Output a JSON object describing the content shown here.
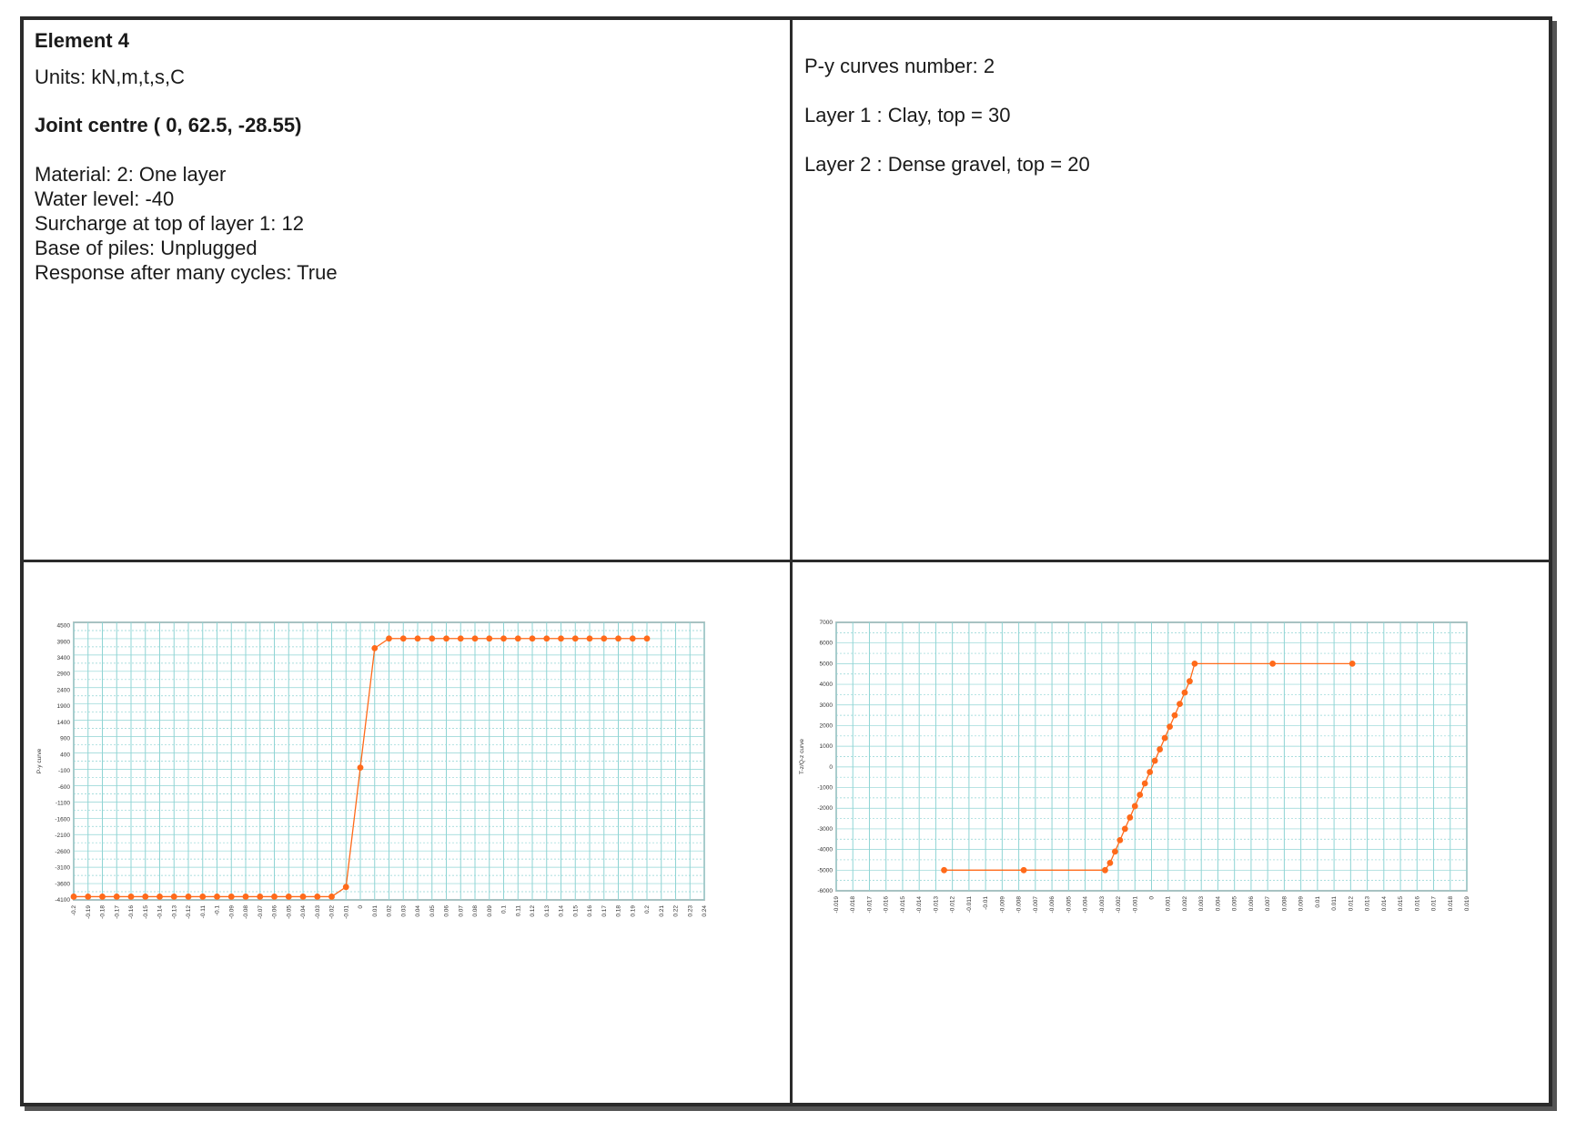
{
  "element": {
    "title": "Element 4",
    "units": "Units: kN,m,t,s,C",
    "joint_centre": "Joint centre ( 0, 62.5, -28.55)",
    "material": "Material: 2: One layer",
    "water_level": "Water level: -40",
    "surcharge": "Surcharge at top of layer 1: 12",
    "base_of_piles": "Base of piles: Unplugged",
    "response": "Response after many cycles: True"
  },
  "layers": {
    "py_curves": "P-y curves number: 2",
    "layer1": "Layer 1 : Clay, top = 30",
    "layer2": "Layer 2 : Dense gravel, top = 20"
  },
  "colors": {
    "grid": "#8fd4d4",
    "series": "#ff6a1a",
    "axis": "#555555"
  },
  "chart_data": [
    {
      "type": "line",
      "ylabel": "P-y curve",
      "xlabel": "",
      "title": "",
      "grid": true,
      "xlim": [
        -0.2,
        0.24
      ],
      "ylim": [
        -4100,
        4500
      ],
      "x_ticks": [
        -0.2,
        -0.19,
        -0.18,
        -0.17,
        -0.16,
        -0.15,
        -0.14,
        -0.13,
        -0.12,
        -0.11,
        -0.1,
        -0.09,
        -0.08,
        -0.07,
        -0.06,
        -0.05,
        -0.04,
        -0.03,
        -0.02,
        -0.01,
        0,
        0.01,
        0.02,
        0.03,
        0.04,
        0.05,
        0.06,
        0.07,
        0.08,
        0.09,
        0.1,
        0.11,
        0.12,
        0.13,
        0.14,
        0.15,
        0.16,
        0.17,
        0.18,
        0.19,
        0.2,
        0.21,
        0.22,
        0.23,
        0.24
      ],
      "y_ticks": [
        -4100,
        -3600,
        -3100,
        -2600,
        -2100,
        -1600,
        -1100,
        -600,
        -100,
        400,
        900,
        1400,
        1900,
        2400,
        2900,
        3400,
        3900,
        4400
      ],
      "y_tick_labels": [
        "-4100",
        "-3600",
        "-3100",
        "-2600",
        "-2100",
        "-1600",
        "-1100",
        "-600",
        "-100",
        "400",
        "900",
        "1400",
        "1900",
        "2400",
        "2900",
        "3400",
        "3900",
        "4500"
      ],
      "series": [
        {
          "x": [
            -0.2,
            -0.19,
            -0.18,
            -0.17,
            -0.16,
            -0.15,
            -0.14,
            -0.13,
            -0.12,
            -0.11,
            -0.1,
            -0.09,
            -0.08,
            -0.07,
            -0.06,
            -0.05,
            -0.04,
            -0.03,
            -0.02,
            -0.01,
            0,
            0.01,
            0.02,
            0.03,
            0.04,
            0.05,
            0.06,
            0.07,
            0.08,
            0.09,
            0.1,
            0.11,
            0.12,
            0.13,
            0.14,
            0.15,
            0.16,
            0.17,
            0.18,
            0.19,
            0.2
          ],
          "y": [
            -4000,
            -4000,
            -4000,
            -4000,
            -4000,
            -4000,
            -4000,
            -4000,
            -4000,
            -4000,
            -4000,
            -4000,
            -4000,
            -4000,
            -4000,
            -4000,
            -4000,
            -4000,
            -4000,
            -3700,
            0,
            3700,
            4000,
            4000,
            4000,
            4000,
            4000,
            4000,
            4000,
            4000,
            4000,
            4000,
            4000,
            4000,
            4000,
            4000,
            4000,
            4000,
            4000,
            4000,
            4000
          ]
        }
      ]
    },
    {
      "type": "line",
      "ylabel": "T-z/Q-z curve",
      "xlabel": "",
      "title": "",
      "grid": true,
      "xlim": [
        -0.019,
        0.019
      ],
      "ylim": [
        -6000,
        7000
      ],
      "x_ticks": [
        -0.019,
        -0.018,
        -0.017,
        -0.016,
        -0.015,
        -0.014,
        -0.013,
        -0.012,
        -0.011,
        -0.01,
        -0.009,
        -0.008,
        -0.007,
        -0.006,
        -0.005,
        -0.004,
        -0.003,
        -0.002,
        -0.001,
        0,
        0.001,
        0.002,
        0.003,
        0.004,
        0.005,
        0.006,
        0.007,
        0.008,
        0.009,
        0.01,
        0.011,
        0.012,
        0.013,
        0.014,
        0.015,
        0.016,
        0.017,
        0.018,
        0.019
      ],
      "y_ticks": [
        -6000,
        -5000,
        -4000,
        -3000,
        -2000,
        -1000,
        0,
        1000,
        2000,
        3000,
        4000,
        5000,
        6000,
        7000
      ],
      "series": [
        {
          "x": [
            -0.0125,
            -0.0077,
            -0.0028,
            -0.0025,
            -0.0022,
            -0.0019,
            -0.0016,
            -0.0013,
            -0.001,
            -0.0007,
            -0.0004,
            -0.0001,
            0.0002,
            0.0005,
            0.0008,
            0.0011,
            0.0014,
            0.0017,
            0.002,
            0.0023,
            0.0026,
            0.0073,
            0.0121
          ],
          "y": [
            -5000,
            -5000,
            -5000,
            -4650,
            -4100,
            -3550,
            -3000,
            -2450,
            -1900,
            -1350,
            -800,
            -250,
            300,
            850,
            1400,
            1950,
            2500,
            3050,
            3600,
            4150,
            5000,
            5000,
            5000
          ]
        }
      ]
    }
  ]
}
